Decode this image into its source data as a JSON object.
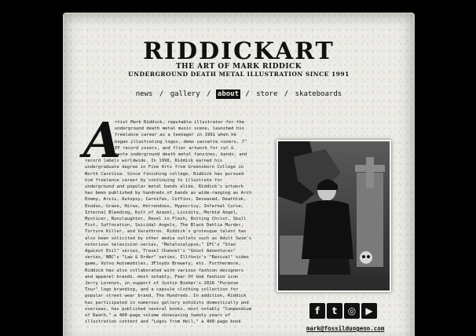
{
  "site": {
    "logo": "RIDDICKART",
    "tagline": "THE ART OF MARK RIDDICK",
    "subtagline": "UNDERGROUND DEATH METAL ILLUSTRATION SINCE 1991"
  },
  "nav": {
    "items": [
      {
        "label": "news"
      },
      {
        "label": "gallery"
      },
      {
        "label": "about",
        "active": true
      },
      {
        "label": "store"
      },
      {
        "label": "skateboards"
      }
    ],
    "separator": "/"
  },
  "bio": {
    "dropcap": "A",
    "lines": [
      "rtist Mark Riddick, reputable illustrator for the",
      "underground death metal music scene, launched his",
      "freelance career as a teenager in 1991 when he",
      "began illustrating logos, demo cassette covers, 7\"",
      "EP record covers, and flier artwork for cut &",
      "paste underground death metal fanzines, bands, and",
      "record labels worldwide. In 1998, Riddick earned his",
      "undergraduate degree in Fine Arts from Greensboro College in",
      "North Carolina. Since finishing college, Riddick has pursued",
      "him freelance career by continuing to illustrate for",
      "underground and popular metal bands alike. Riddick's artwork",
      "has been published by hundreds of bands as wide-ranging as Arch",
      "Enemy, Arsis, Autopsy, Carnifex, Coffins, Deceased, Deathlok,",
      "Exodus, Grave, Hirax, Horrendous, Hypocrisy, Infernal Curse,",
      "Internal Bleeding, Kult of Azazel, Lividity, Morbid Angel,",
      "Mysticer, Runslaughter, Revel in Flesh, Rotting Christ, Skull",
      "Fist, Suffocation, Suicidal Angels, The Black Dahlia Murder,",
      "Torture Killer, and Varathron. Riddick's grotesque talent has",
      "also been solicited by other media outlets such as Adult Swim's",
      "notorious television series, \"Metalocalypse,\" IFC's \"Stan",
      "Against Evil\" series, Travel Channel's \"Ghost Adventures\"",
      "series, NBC's \"Law & Order\" series, Illfonic's \"Revival\" video",
      "game, Volvo Automobiles, 3Floyds Brewery, etc. Furthermore,",
      "Riddick has also collaborated with various fashion designers",
      "and apparel brands, most notably, Fear Of God fashion icon",
      "Jerry Lorenzo, in support of Justin Bieber's 2016 \"Purpose",
      "Tour\" logo branding, and a capsule clothing collection for",
      "popular street wear brand, The Hundreds. In addition, Riddick",
      "has participated in numerous gallery exhibits domestically and",
      "overseas, has published several books, most notably \"Compendium",
      "of Death,\" a 400-page volume showcasing twenty years of",
      "illustration content and \"Logos from Hell,\" a 400-page book"
    ]
  },
  "photo": {
    "alt": "Mark Riddick portrait"
  },
  "social": {
    "icons": [
      "facebook-icon",
      "twitter-icon",
      "instagram-icon",
      "youtube-icon"
    ],
    "glyphs": [
      "f",
      "t",
      "◎",
      "▶"
    ]
  },
  "contact": {
    "email": "mark@fossildungeon.com"
  }
}
